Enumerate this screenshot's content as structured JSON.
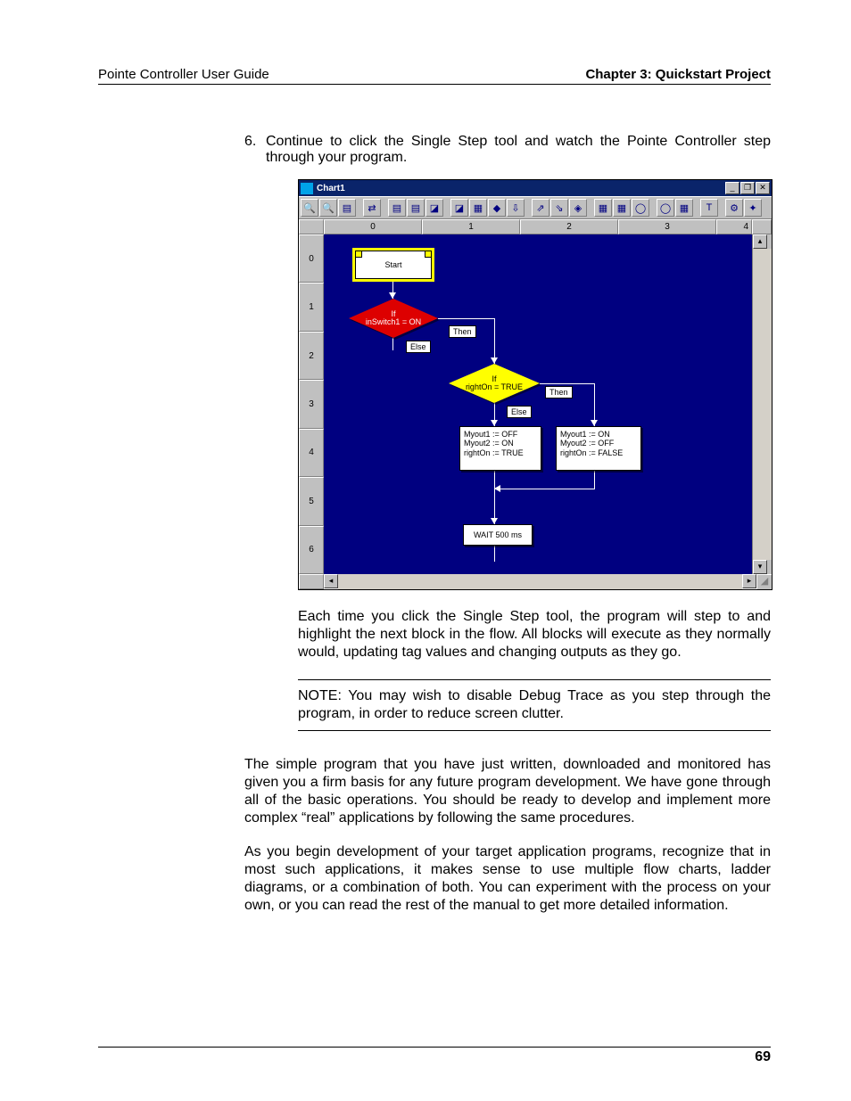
{
  "header": {
    "left": "Pointe Controller User Guide",
    "right": "Chapter 3: Quickstart Project"
  },
  "step_number": "6.",
  "step_text": "Continue to click the Single Step tool and watch the Pointe Controller step through your program.",
  "window": {
    "title": "Chart1",
    "min_glyph": "_",
    "max_glyph": "❐",
    "close_glyph": "✕",
    "cols": [
      "0",
      "1",
      "2",
      "3",
      "4"
    ],
    "rows": [
      "0",
      "1",
      "2",
      "3",
      "4",
      "5",
      "6"
    ],
    "toolbar_glyphs": [
      "🔍",
      "🔍",
      "▤",
      "⇄",
      "▤",
      "▤",
      "◪",
      "◪",
      "▦",
      "◆",
      "⇩",
      "⇗",
      "⇘",
      "◈",
      "▦",
      "▦",
      "◯",
      "◯",
      "▦",
      "T",
      "⚙",
      "✦"
    ]
  },
  "chart_data": {
    "type": "diagram",
    "nodes": [
      {
        "id": "start",
        "kind": "terminator",
        "label": "Start",
        "row": 0,
        "col": 0,
        "selected": true
      },
      {
        "id": "d1",
        "kind": "decision",
        "label_line1": "If",
        "label_line2": "inSwitch1 =  ON",
        "row": 1,
        "col": 0,
        "active": true,
        "selected": true
      },
      {
        "id": "d2",
        "kind": "decision",
        "label_line1": "If",
        "label_line2": "rightOn =  TRUE",
        "row": 2,
        "col": 1
      },
      {
        "id": "pA",
        "kind": "process",
        "lines": [
          "Myout1 :=  OFF",
          "Myout2 :=  ON",
          "rightOn :=  TRUE"
        ],
        "row": 3,
        "col": 1
      },
      {
        "id": "pB",
        "kind": "process",
        "lines": [
          "Myout1 :=  ON",
          "Myout2 :=  OFF",
          "rightOn :=  FALSE"
        ],
        "row": 3,
        "col": 2
      },
      {
        "id": "wait",
        "kind": "process",
        "lines": [
          "WAIT 500 ms"
        ],
        "row": 5,
        "col": 1
      }
    ],
    "edges": [
      {
        "from": "start",
        "to": "d1"
      },
      {
        "from": "d1",
        "to": "d2",
        "label": "Then"
      },
      {
        "from": "d1",
        "to": "d1",
        "label": "Else"
      },
      {
        "from": "d2",
        "to": "pB",
        "label": "Then"
      },
      {
        "from": "d2",
        "to": "pA",
        "label": "Else"
      },
      {
        "from": "pA",
        "to": "wait"
      },
      {
        "from": "pB",
        "to": "wait"
      },
      {
        "from": "wait",
        "to": "d1"
      }
    ],
    "labels": {
      "then": "Then",
      "else": "Else"
    }
  },
  "flow": {
    "start": "Start",
    "d1_l1": "If",
    "d1_l2": "inSwitch1 =  ON",
    "then": "Then",
    "else": "Else",
    "d2_l1": "If",
    "d2_l2": "rightOn =  TRUE",
    "pA_l1": "Myout1 :=  OFF",
    "pA_l2": "Myout2 :=  ON",
    "pA_l3": "rightOn :=  TRUE",
    "pB_l1": "Myout1 :=  ON",
    "pB_l2": "Myout2 :=  OFF",
    "pB_l3": "rightOn :=  FALSE",
    "wait": "WAIT 500 ms"
  },
  "para1": "Each time you click the Single Step tool, the program will step to and highlight the next block in the flow. All blocks will execute as they normally would, updating tag values and changing outputs as they go.",
  "note": "NOTE: You may wish to disable Debug Trace as you step through the program, in order to reduce screen clutter.",
  "para2": "The simple program that you have just written, downloaded and monitored has given you a firm basis for any future program development. We have gone through all of the basic operations. You should be ready to develop and implement more complex “real” applications by following the same procedures.",
  "para3": "As you begin development of your target application programs, recognize that in most such applications, it makes sense to use multiple flow charts, ladder diagrams, or a combination of both. You can experiment with the process on your own, or you can read the rest of the manual to get more detailed information.",
  "page_number": "69"
}
